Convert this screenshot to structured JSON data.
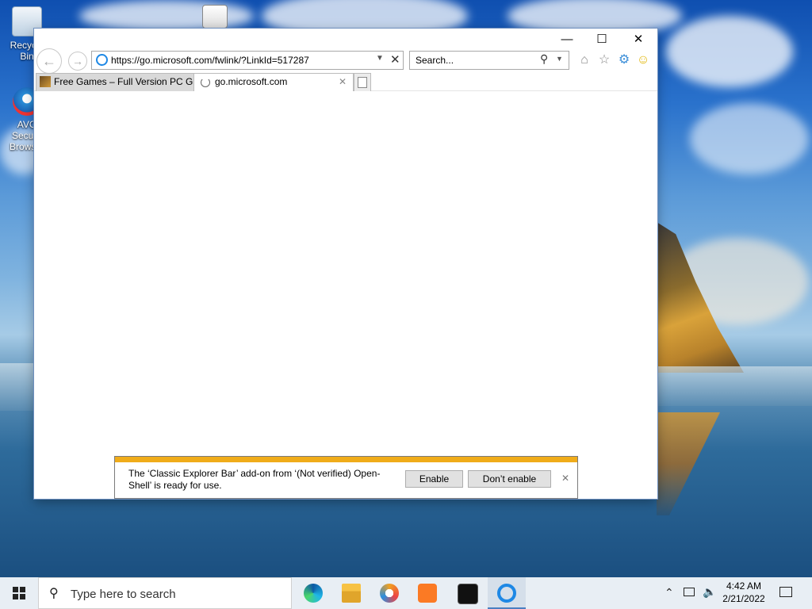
{
  "desktop": {
    "icons": [
      {
        "label": "Recycle Bin"
      },
      {
        "label": "AVG Secure Browser"
      }
    ]
  },
  "browser": {
    "address_url": "https://go.microsoft.com/fwlink/?LinkId=517287",
    "search_placeholder": "Search...",
    "tabs": [
      {
        "label": "Free Games – Full Version PC G..."
      },
      {
        "label": "go.microsoft.com"
      }
    ]
  },
  "notification": {
    "message": "The ‘Classic Explorer Bar’ add-on from ‘(Not verified) Open-Shell’ is ready for use.",
    "enable_label": "Enable",
    "dont_enable_label": "Don’t enable"
  },
  "taskbar": {
    "search_placeholder": "Type here to search",
    "time": "4:42 AM",
    "date": "2/21/2022"
  },
  "colors": {
    "notification_stripe": "#f0ac1a",
    "taskbar_bg": "#e8eef4",
    "ie_blue": "#1e88e5"
  },
  "icons": [
    "recycle-bin-icon",
    "avg-browser-icon",
    "back-icon",
    "forward-icon",
    "ie-page-icon",
    "dropdown-icon",
    "clear-icon",
    "search-icon",
    "home-icon",
    "favorites-star-icon",
    "gear-icon",
    "smiley-icon",
    "tab-game-icon",
    "tab-loading-icon",
    "new-tab-icon",
    "windows-start-icon",
    "edge-icon",
    "file-explorer-icon",
    "chrome-like-icon",
    "xampp-icon",
    "terminal-icon",
    "internet-explorer-icon",
    "chevron-up-icon",
    "network-icon",
    "volume-icon",
    "notification-center-icon"
  ]
}
